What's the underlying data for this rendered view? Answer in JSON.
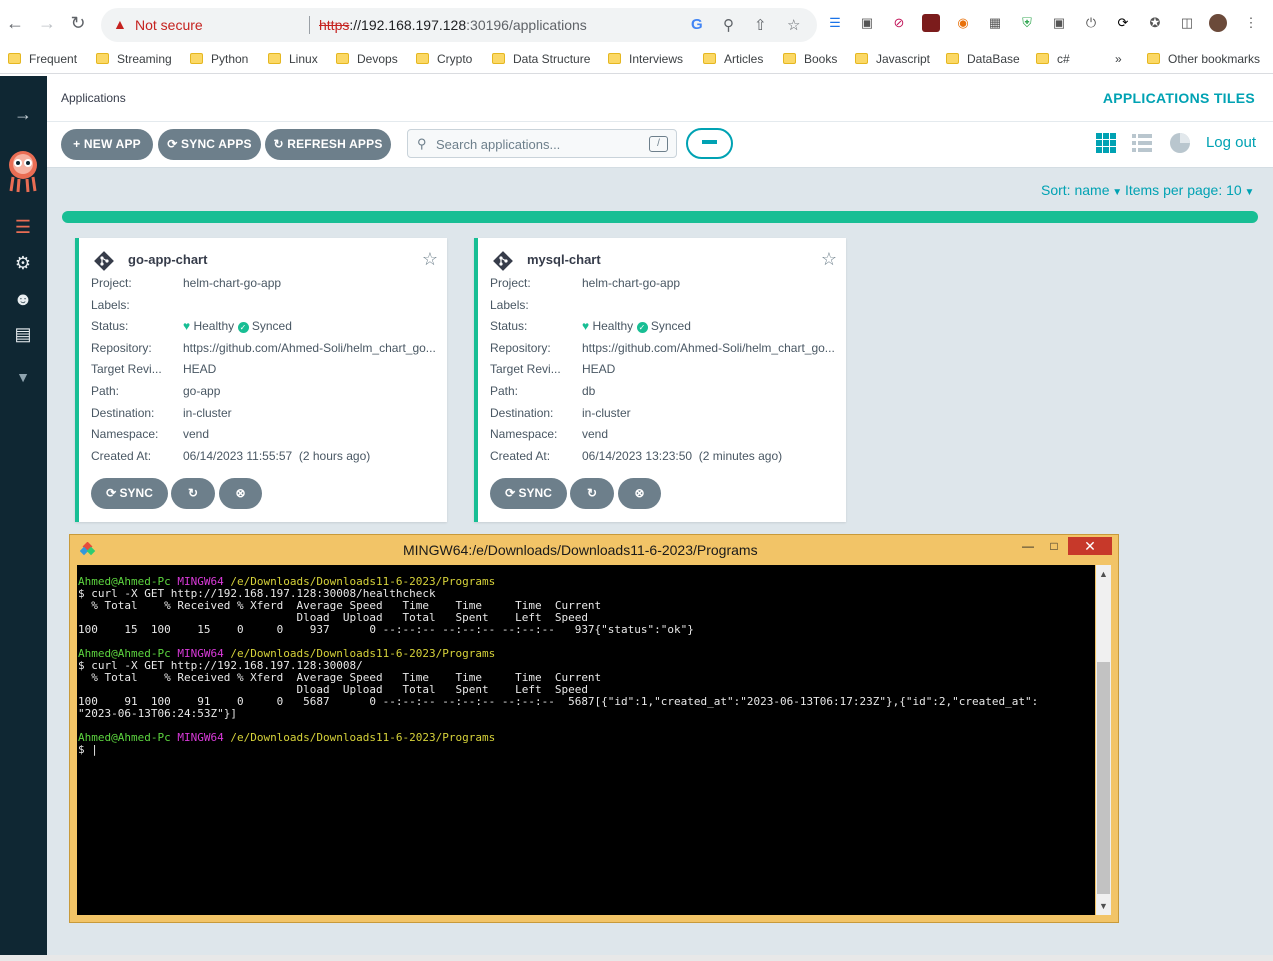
{
  "browser": {
    "security_label": "Not secure",
    "url_scheme": "https",
    "url_host": "://192.168.197.128",
    "url_path": ":30196/applications",
    "bookmarks": [
      "Frequent",
      "Streaming",
      "Python",
      "Linux",
      "Devops",
      "Crypto",
      "Data Structure",
      "Interviews",
      "Articles",
      "Books",
      "Javascript",
      "DataBase",
      "c#"
    ],
    "more_label": "»",
    "other_bookmarks": "Other bookmarks"
  },
  "header": {
    "breadcrumb": "Applications",
    "view_title": "APPLICATIONS TILES",
    "logout": "Log out"
  },
  "actions": {
    "new_app": "NEW APP",
    "sync_apps": "SYNC APPS",
    "refresh_apps": "REFRESH APPS",
    "search_placeholder": "Search applications...",
    "search_shortcut": "/"
  },
  "sort": {
    "sort_label": "Sort: name",
    "per_page_label": "Items per page: 10"
  },
  "apps": [
    {
      "name": "go-app-chart",
      "fields": [
        {
          "k": "Project:",
          "v": "helm-chart-go-app"
        },
        {
          "k": "Labels:",
          "v": ""
        },
        {
          "k": "Status:",
          "v": ""
        },
        {
          "k": "Repository:",
          "v": "https://github.com/Ahmed-Soli/helm_chart_go..."
        },
        {
          "k": "Target Revi...",
          "v": "HEAD"
        },
        {
          "k": "Path:",
          "v": "go-app"
        },
        {
          "k": "Destination:",
          "v": "in-cluster"
        },
        {
          "k": "Namespace:",
          "v": "vend"
        },
        {
          "k": "Created At:",
          "v": "06/14/2023 11:55:57  (2 hours ago)"
        }
      ],
      "health": "Healthy",
      "sync": "Synced",
      "sync_button": "SYNC"
    },
    {
      "name": "mysql-chart",
      "fields": [
        {
          "k": "Project:",
          "v": "helm-chart-go-app"
        },
        {
          "k": "Labels:",
          "v": ""
        },
        {
          "k": "Status:",
          "v": ""
        },
        {
          "k": "Repository:",
          "v": "https://github.com/Ahmed-Soli/helm_chart_go..."
        },
        {
          "k": "Target Revi...",
          "v": "HEAD"
        },
        {
          "k": "Path:",
          "v": "db"
        },
        {
          "k": "Destination:",
          "v": "in-cluster"
        },
        {
          "k": "Namespace:",
          "v": "vend"
        },
        {
          "k": "Created At:",
          "v": "06/14/2023 13:23:50  (2 minutes ago)"
        }
      ],
      "health": "Healthy",
      "sync": "Synced",
      "sync_button": "SYNC"
    }
  ],
  "terminal": {
    "title": "MINGW64:/e/Downloads/Downloads11-6-2023/Programs",
    "user": "Ahmed@Ahmed-Pc",
    "shell": "MINGW64",
    "cwd": "/e/Downloads/Downloads11-6-2023/Programs",
    "cmd1": "$ curl -X GET http://192.168.197.128:30008/healthcheck",
    "hdr1": "  % Total    % Received % Xferd  Average Speed   Time    Time     Time  Current",
    "hdr2": "                                 Dload  Upload   Total   Spent    Left  Speed",
    "out1": "100    15  100    15    0     0    937      0 --:--:-- --:--:-- --:--:--   937{\"status\":\"ok\"}",
    "cmd2": "$ curl -X GET http://192.168.197.128:30008/",
    "out2a": "100    91  100    91    0     0   5687      0 --:--:-- --:--:-- --:--:--  5687[{\"id\":1,\"created_at\":\"2023-06-13T06:17:23Z\"},{\"id\":2,\"created_at\":",
    "out2b": "\"2023-06-13T06:24:53Z\"}]",
    "prompt": "$ |"
  },
  "colors": {
    "accent": "#00a2b3",
    "healthy": "#18be94",
    "sidebar": "#0f2733"
  }
}
